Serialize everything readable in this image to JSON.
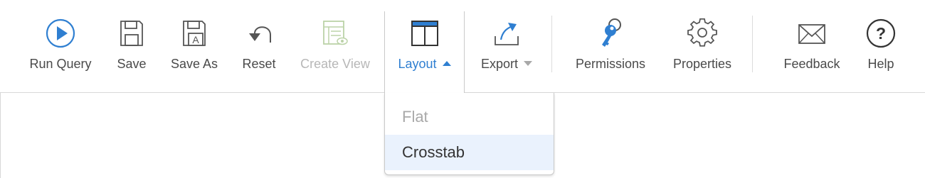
{
  "toolbar": {
    "items": [
      {
        "label": "Run Query",
        "icon": "play-circle-icon"
      },
      {
        "label": "Save",
        "icon": "floppy-icon"
      },
      {
        "label": "Save As",
        "icon": "floppy-a-icon"
      },
      {
        "label": "Reset",
        "icon": "undo-icon"
      },
      {
        "label": "Create View",
        "icon": "create-view-icon"
      },
      {
        "label": "Layout",
        "icon": "layout-table-icon"
      },
      {
        "label": "Export",
        "icon": "export-icon"
      },
      {
        "label": "Permissions",
        "icon": "keys-icon"
      },
      {
        "label": "Properties",
        "icon": "gear-icon"
      },
      {
        "label": "Feedback",
        "icon": "envelope-icon"
      },
      {
        "label": "Help",
        "icon": "help-circle-icon"
      }
    ]
  },
  "layout_menu": {
    "options": [
      {
        "label": "Flat",
        "state": "disabled"
      },
      {
        "label": "Crosstab",
        "state": "selected"
      }
    ]
  },
  "colors": {
    "accent": "#2f7fd1",
    "icon_gray": "#555555",
    "disabled": "#b7b7b7",
    "selected_bg": "#eaf2fd"
  }
}
